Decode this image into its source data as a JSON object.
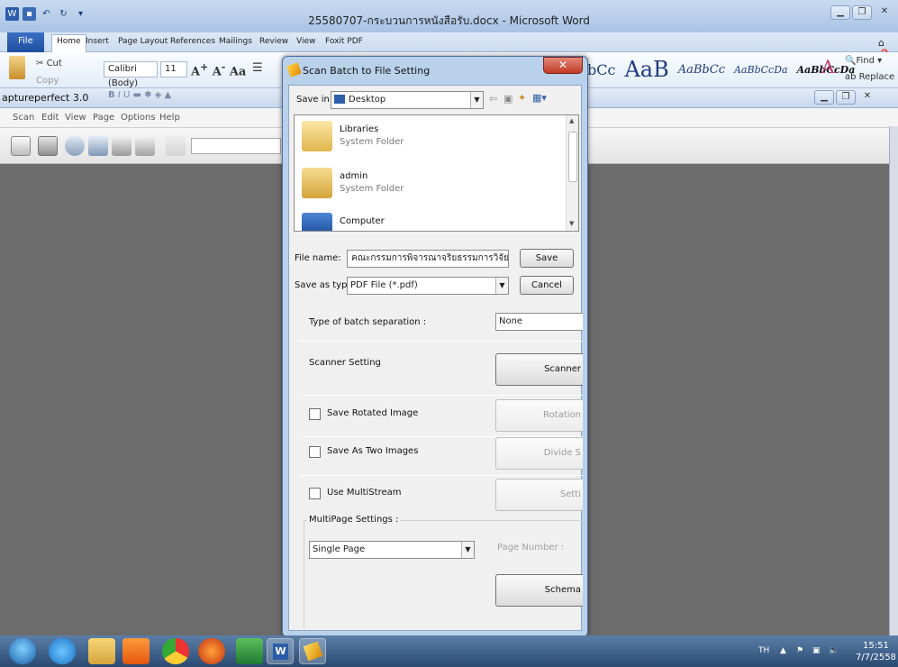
{
  "word": {
    "title": "25580707-กระบวนการหนังสือรับ.docx - Microsoft Word",
    "tabs": [
      "File",
      "Home",
      "Insert",
      "Page Layout",
      "References",
      "Mailings",
      "Review",
      "View",
      "Foxit PDF"
    ],
    "clipboard": {
      "cut": "Cut",
      "copy": "Copy"
    },
    "font_name": "Calibri (Body)",
    "font_size": "11",
    "styles": [
      "bCc",
      "AaB",
      "AaBbCc",
      "AaBbCcDa",
      "AaBbCcDa"
    ],
    "find": "Find",
    "replace": "Replace"
  },
  "capture": {
    "title": "aptureperfect 3.0",
    "menu": [
      "Scan",
      "Edit",
      "View",
      "Page",
      "Options",
      "Help"
    ]
  },
  "dialog": {
    "title": "Scan Batch to File Setting",
    "save_in_label": "Save in:",
    "save_in_value": "Desktop",
    "files": [
      {
        "name": "Libraries",
        "sub": "System Folder"
      },
      {
        "name": "admin",
        "sub": "System Folder"
      },
      {
        "name": "Computer",
        "sub": ""
      }
    ],
    "file_name_label": "File name:",
    "file_name_value": "คณะกรรมการพิจารณาจริยธรรมการวิจัย",
    "save_as_type_label": "Save as type:",
    "save_as_type_value": "PDF File (*.pdf)",
    "save_button": "Save",
    "cancel_button": "Cancel",
    "batch_sep_label": "Type of batch separation :",
    "batch_sep_value": "None",
    "scanner_setting_label": "Scanner Setting",
    "scanner_button": "Scanner",
    "save_rotated_label": "Save Rotated Image",
    "rotation_button": "Rotation",
    "save_two_label": "Save As Two Images",
    "divide_button": "Divide S",
    "multistream_label": "Use MultiStream",
    "setting_button": "Setti",
    "multipage_label": "MultiPage Settings :",
    "multipage_value": "Single Page",
    "page_number_label": "Page Number :",
    "schema_button": "Schema"
  },
  "taskbar": {
    "lang": "TH",
    "time": "15:51",
    "date": "7/7/2558"
  },
  "colors": {
    "word_blue": "#1f4f9e",
    "dialog_frame": "#b9d1ea",
    "close_red": "#c03a26",
    "taskbar": "#2a4a72"
  }
}
